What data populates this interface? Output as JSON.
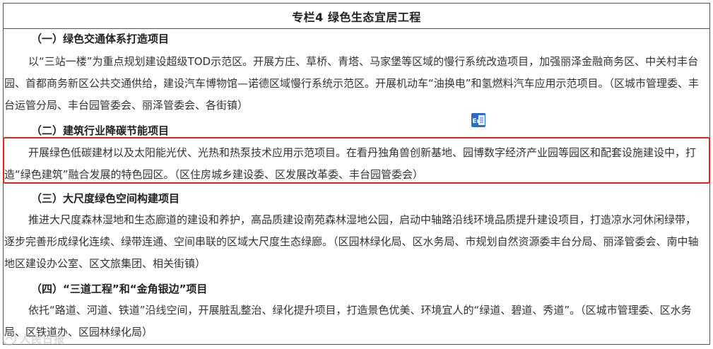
{
  "table": {
    "title": "专栏4  绿色生态宜居工程"
  },
  "sections": [
    {
      "heading": "（一）绿色交通体系打造项目",
      "body": "以“三站一楼”为重点规划建设超级TOD示范区。开展方庄、草桥、青塔、马家堡等区域的慢行系统改造项目，加强丽泽金融商务区、中关村丰台园、首都商务新区公共交通供给，建设汽车博物馆—诺德区域慢行系统示范区。开展机动车“油换电”和氢燃料汽车应用示范项目。（区城市管理委、丰台运管分局、丰台园管委会、丽泽管委会、各街镇）"
    },
    {
      "heading": "（二）建筑行业降碳节能项目",
      "body": "开展绿色低碳建材以及太阳能光伏、光热和热泵技术应用示范项目。在看丹独角兽创新基地、园博数字经济产业园等园区和配套设施建设中，打造“绿色建筑”融合发展的特色园区。（区住房城乡建设委、区发展改革委、丰台园管委会）"
    },
    {
      "heading": "（三）大尺度绿色空间构建项目",
      "body": "推进大尺度森林湿地和生态廊道的建设和养护，高品质建设南苑森林湿地公园，启动中轴路沿线环境品质提升建设项目，打造凉水河休闲绿带，逐步完善形成绿化连续、绿带连通、空间串联的区域大尺度生态绿廊。（区园林绿化局、区水务局、市规划自然资源委丰台分局、丽泽管委会、南中轴地区建设办公室、区文旅集团、相关街镇）"
    },
    {
      "heading": "（四）“三道工程”和“金角银边”项目",
      "body": "依托“路道、河道、铁道”沿线空间，开展脏乱整治、绿化提升项目，打造景色优美、环境宜人的“绿道、碧道、秀道”。（区城市管理委、区水务局、区铁道办、区园林绿化局）"
    }
  ],
  "overlay": {
    "translate_icon": "word-translate-icon",
    "watermark_text": "人民日报",
    "highlight_color": "#e5231e"
  }
}
